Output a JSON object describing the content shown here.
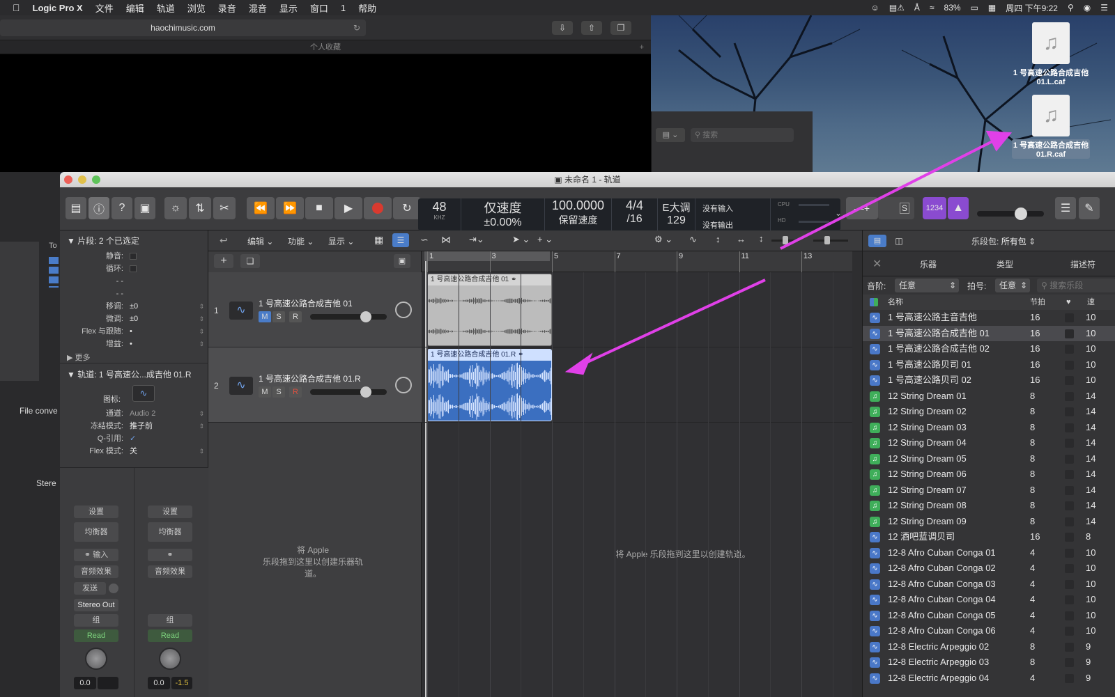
{
  "menubar": {
    "apple": "",
    "app": "Logic Pro X",
    "items": [
      "文件",
      "编辑",
      "轨道",
      "浏览",
      "录音",
      "混音",
      "显示",
      "窗口",
      "1",
      "帮助"
    ],
    "battery": "83%",
    "clock": "周四 下午9:22"
  },
  "safari": {
    "url": "haochimusic.com",
    "tab": "个人收藏"
  },
  "finder": {
    "search_placeholder": "搜索"
  },
  "desktop_icons": [
    {
      "label": "1 号高速公路合成吉他 01.L.caf"
    },
    {
      "label": "1 号高速公路合成吉他 01.R.caf"
    }
  ],
  "bgwin": {
    "file_conv": "File conve",
    "stereo": "Stere",
    "to": "To"
  },
  "window": {
    "title": "未命名 1 - 轨道"
  },
  "lcd": {
    "rate": "48",
    "rate_unit": "KHZ",
    "tempo_mode": "仅速度",
    "tempo_offset": "±0.00%",
    "tempo": "100.0000",
    "tempo_label": "保留速度",
    "sig_top": "4/4",
    "sig_bottom": "/16",
    "key": "E大调",
    "key_value": "129",
    "input": "没有输入",
    "output": "没有输出",
    "cpu": "CPU",
    "hd": "HD"
  },
  "toolbar": {
    "count_in": "1234",
    "s": "S"
  },
  "inspector": {
    "region_header": "▼ 片段:  2 个已选定",
    "region_rows": [
      {
        "label": "静音:",
        "value": ""
      },
      {
        "label": "循环:",
        "value": ""
      },
      {
        "label": "- -",
        "value": ""
      },
      {
        "label": "- -",
        "value": ""
      },
      {
        "label": "移调:",
        "value": "±0"
      },
      {
        "label": "微调:",
        "value": "±0"
      },
      {
        "label": "Flex 与跟随:",
        "value": "•"
      },
      {
        "label": "增益:",
        "value": "•"
      }
    ],
    "more": "▶ 更多",
    "track_header": "▼ 轨道:  1 号高速公...成吉他 01.R",
    "icon_label": "图标:",
    "track_rows": [
      {
        "label": "通道:",
        "value": "Audio 2"
      },
      {
        "label": "冻结模式:",
        "value": "推子前"
      },
      {
        "label": "Q-引用:",
        "value": "✓"
      },
      {
        "label": "Flex 模式:",
        "value": "关"
      }
    ],
    "strip_left": {
      "settings": "设置",
      "eq": "均衡器",
      "input": "输入",
      "fx": "音频效果",
      "send": "发送",
      "out": "Stereo Out",
      "group": "组",
      "auto": "Read",
      "vol": "0.0"
    },
    "strip_right": {
      "settings": "设置",
      "eq": "均衡器",
      "fx": "音频效果",
      "group": "组",
      "auto": "Read",
      "vol": "0.0",
      "peak": "-1.5"
    }
  },
  "arrange_header": {
    "edit": "编辑",
    "func": "功能",
    "view": "显示"
  },
  "ruler": [
    "1",
    "3",
    "5",
    "7",
    "9",
    "11",
    "13"
  ],
  "tracks": [
    {
      "num": "1",
      "name": "1 号高速公路合成吉他 01",
      "m": "M",
      "s": "S",
      "r": "R"
    },
    {
      "num": "2",
      "name": "1 号高速公路合成吉他 01.R",
      "m": "M",
      "s": "S",
      "r": "R"
    }
  ],
  "regions": [
    {
      "name": "1 号高速公路合成吉他 01"
    },
    {
      "name": "1 号高速公路合成吉他 01.R"
    }
  ],
  "drop_hint_left": "将 Apple\n乐段拖到这里以创建乐器轨\n道。",
  "drop_hint_right": "将 Apple 乐段拖到这里以创建轨道。",
  "loops": {
    "pack_label": "乐段包:",
    "pack_value": "所有包",
    "tabs": [
      "乐器",
      "类型",
      "描述符"
    ],
    "scale_label": "音阶:",
    "scale_value": "任意",
    "sig_label": "拍号:",
    "sig_value": "任意",
    "search_placeholder": "搜索乐段",
    "col_name": "名称",
    "col_beats": "节拍",
    "col_fav": "♥",
    "col_tempo": "速",
    "rows": [
      {
        "name": "1 号高速公路主音吉他",
        "beats": "16",
        "tempo": "10",
        "kind": "audio"
      },
      {
        "name": "1 号高速公路合成吉他 01",
        "beats": "16",
        "tempo": "10",
        "kind": "audio"
      },
      {
        "name": "1 号高速公路合成吉他 02",
        "beats": "16",
        "tempo": "10",
        "kind": "audio"
      },
      {
        "name": "1 号高速公路贝司 01",
        "beats": "16",
        "tempo": "10",
        "kind": "audio"
      },
      {
        "name": "1 号高速公路贝司 02",
        "beats": "16",
        "tempo": "10",
        "kind": "audio"
      },
      {
        "name": "12 String Dream 01",
        "beats": "8",
        "tempo": "14",
        "kind": "midi"
      },
      {
        "name": "12 String Dream 02",
        "beats": "8",
        "tempo": "14",
        "kind": "midi"
      },
      {
        "name": "12 String Dream 03",
        "beats": "8",
        "tempo": "14",
        "kind": "midi"
      },
      {
        "name": "12 String Dream 04",
        "beats": "8",
        "tempo": "14",
        "kind": "midi"
      },
      {
        "name": "12 String Dream 05",
        "beats": "8",
        "tempo": "14",
        "kind": "midi"
      },
      {
        "name": "12 String Dream 06",
        "beats": "8",
        "tempo": "14",
        "kind": "midi"
      },
      {
        "name": "12 String Dream 07",
        "beats": "8",
        "tempo": "14",
        "kind": "midi"
      },
      {
        "name": "12 String Dream 08",
        "beats": "8",
        "tempo": "14",
        "kind": "midi"
      },
      {
        "name": "12 String Dream 09",
        "beats": "8",
        "tempo": "14",
        "kind": "midi"
      },
      {
        "name": "12 酒吧蓝调贝司",
        "beats": "16",
        "tempo": "8",
        "kind": "audio"
      },
      {
        "name": "12-8 Afro Cuban Conga 01",
        "beats": "4",
        "tempo": "10",
        "kind": "audio"
      },
      {
        "name": "12-8 Afro Cuban Conga 02",
        "beats": "4",
        "tempo": "10",
        "kind": "audio"
      },
      {
        "name": "12-8 Afro Cuban Conga 03",
        "beats": "4",
        "tempo": "10",
        "kind": "audio"
      },
      {
        "name": "12-8 Afro Cuban Conga 04",
        "beats": "4",
        "tempo": "10",
        "kind": "audio"
      },
      {
        "name": "12-8 Afro Cuban Conga 05",
        "beats": "4",
        "tempo": "10",
        "kind": "audio"
      },
      {
        "name": "12-8 Afro Cuban Conga 06",
        "beats": "4",
        "tempo": "10",
        "kind": "audio"
      },
      {
        "name": "12-8 Electric Arpeggio 02",
        "beats": "8",
        "tempo": "9",
        "kind": "audio"
      },
      {
        "name": "12-8 Electric Arpeggio 03",
        "beats": "8",
        "tempo": "9",
        "kind": "audio"
      },
      {
        "name": "12-8 Electric Arpeggio 04",
        "beats": "4",
        "tempo": "9",
        "kind": "audio"
      }
    ]
  },
  "colors": {
    "audio_icon": "#4a78c8",
    "midi_icon": "#3fae5a",
    "arrow": "#e040e8",
    "record": "#d93a2f"
  }
}
